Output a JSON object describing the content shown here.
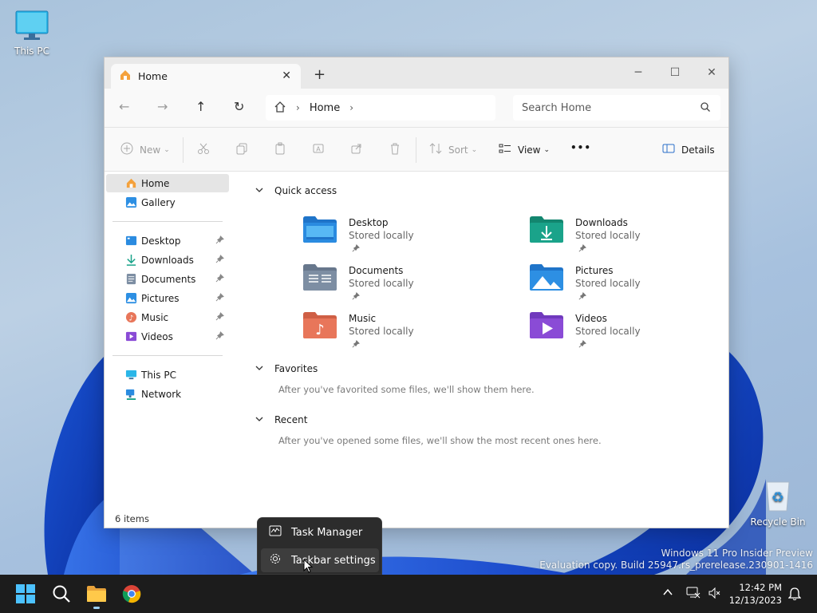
{
  "desktop": {
    "this_pc_label": "This PC",
    "recycle_bin_label": "Recycle Bin",
    "watermark_line1": "Windows 11 Pro Insider Preview",
    "watermark_line2": "Evaluation copy. Build 25947.rs_prerelease.230901-1416"
  },
  "window": {
    "tab_title": "Home",
    "breadcrumb_home": "Home",
    "search_placeholder": "Search Home",
    "toolbar": {
      "new_label": "New",
      "sort_label": "Sort",
      "view_label": "View",
      "more_label": "•••",
      "details_label": "Details"
    },
    "sidebar": {
      "top": [
        {
          "label": "Home",
          "icon": "home-icon"
        },
        {
          "label": "Gallery",
          "icon": "gallery-icon"
        }
      ],
      "pinned": [
        {
          "label": "Desktop",
          "icon": "desktop-folder-icon"
        },
        {
          "label": "Downloads",
          "icon": "downloads-icon"
        },
        {
          "label": "Documents",
          "icon": "documents-icon"
        },
        {
          "label": "Pictures",
          "icon": "pictures-icon"
        },
        {
          "label": "Music",
          "icon": "music-icon"
        },
        {
          "label": "Videos",
          "icon": "videos-icon"
        }
      ],
      "bottom": [
        {
          "label": "This PC",
          "icon": "this-pc-icon"
        },
        {
          "label": "Network",
          "icon": "network-icon"
        }
      ]
    },
    "quick_access": {
      "heading": "Quick access",
      "items": [
        {
          "name": "Desktop",
          "sub": "Stored locally",
          "color": "#2a8be0"
        },
        {
          "name": "Downloads",
          "sub": "Stored locally",
          "color": "#1aa38a"
        },
        {
          "name": "Documents",
          "sub": "Stored locally",
          "color": "#7d8ea3"
        },
        {
          "name": "Pictures",
          "sub": "Stored locally",
          "color": "#2d8fe3"
        },
        {
          "name": "Music",
          "sub": "Stored locally",
          "color": "#e8765a"
        },
        {
          "name": "Videos",
          "sub": "Stored locally",
          "color": "#8a4bd6"
        }
      ]
    },
    "favorites": {
      "heading": "Favorites",
      "empty_text": "After you've favorited some files, we'll show them here."
    },
    "recent": {
      "heading": "Recent",
      "empty_text": "After you've opened some files, we'll show the most recent ones here."
    },
    "status": "6 items"
  },
  "context_menu": {
    "items": [
      {
        "label": "Task Manager",
        "icon": "task-manager-icon"
      },
      {
        "label": "Taskbar settings",
        "icon": "settings-gear-icon"
      }
    ]
  },
  "taskbar": {
    "time": "12:42 PM",
    "date": "12/13/2023"
  }
}
